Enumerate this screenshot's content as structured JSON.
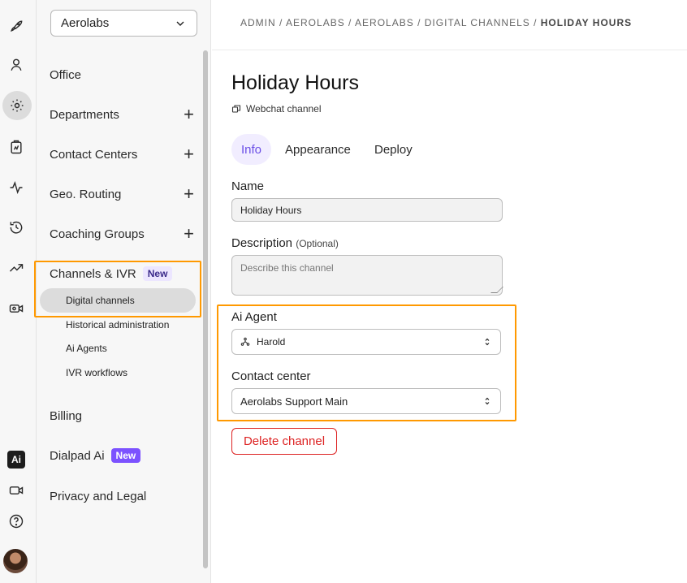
{
  "rail": {
    "icons": [
      "rocket-icon",
      "user-icon",
      "gear-icon",
      "clipboard-icon",
      "activity-icon",
      "history-icon",
      "trending-icon",
      "video-settings-icon",
      "dialpad-ai-icon",
      "video-icon",
      "help-icon"
    ],
    "ai_chip_label": "Ai"
  },
  "sidebar": {
    "org_select": "Aerolabs",
    "items": [
      {
        "label": "Office",
        "expandable": false
      },
      {
        "label": "Departments",
        "expandable": true
      },
      {
        "label": "Contact Centers",
        "expandable": true
      },
      {
        "label": "Geo. Routing",
        "expandable": true
      },
      {
        "label": "Coaching Groups",
        "expandable": true
      },
      {
        "label": "Channels & IVR",
        "badge": "New"
      },
      {
        "label": "Billing"
      },
      {
        "label": "Dialpad Ai",
        "badge": "New"
      },
      {
        "label": "Privacy and Legal"
      }
    ],
    "plus_symbol": "+",
    "subitems": [
      "Digital channels",
      "Historical administration",
      "Ai Agents",
      "IVR workflows"
    ],
    "active_subitem": "Digital channels"
  },
  "breadcrumb": {
    "trail": "ADMIN / AEROLABS / AEROLABS / DIGITAL CHANNELS / ",
    "current": "HOLIDAY HOURS"
  },
  "page": {
    "title": "Holiday Hours",
    "subtitle": "Webchat channel"
  },
  "tabs": [
    "Info",
    "Appearance",
    "Deploy"
  ],
  "form": {
    "name_label": "Name",
    "name_value": "Holiday Hours",
    "description_label": "Description",
    "description_optional": "(Optional)",
    "description_placeholder": "Describe this channel",
    "agent_label": "Ai Agent",
    "agent_value": "Harold",
    "contact_center_label": "Contact center",
    "contact_center_value": "Aerolabs Support Main",
    "delete_button": "Delete channel"
  },
  "colors": {
    "accent": "#7c52ff",
    "highlight": "#ff9900",
    "danger": "#dd2222"
  }
}
